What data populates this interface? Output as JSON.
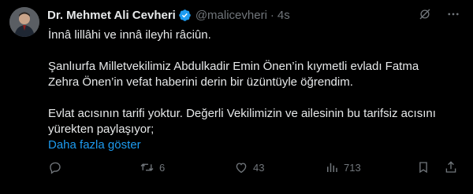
{
  "author": {
    "name": "Dr. Mehmet Ali Cevheri",
    "handle": "@malicevheri",
    "separator": "·",
    "time": "4s"
  },
  "tweet": {
    "line1": "İnnâ lillâhi ve innâ ileyhi râciûn.",
    "para2_line1": "Şanlıurfa Milletvekilimiz Abdulkadir Emin Önen’in kıymetli evladı Fatma",
    "para2_line2": "Zehra Önen’in vefat haberini derin bir üzüntüyle öğrendim.",
    "para3_line1": "Evlat acısının tarifi yoktur. Değerli Vekilimizin ve ailesinin bu tarifsiz acısını",
    "para3_line2": "yürekten paylaşıyor;",
    "show_more": "Daha fazla göster"
  },
  "actions": {
    "reply_count": "",
    "retweet_count": "6",
    "like_count": "43",
    "views_count": "713"
  },
  "icons": [
    "verified-badge-icon",
    "grok-icon",
    "more-icon",
    "reply-icon",
    "retweet-icon",
    "like-icon",
    "views-icon",
    "bookmark-icon",
    "share-icon"
  ],
  "colors": {
    "background": "#000000",
    "text": "#e7e9ea",
    "muted": "#71767b",
    "link": "#1d9bf0",
    "verified": "#1d9bf0"
  }
}
